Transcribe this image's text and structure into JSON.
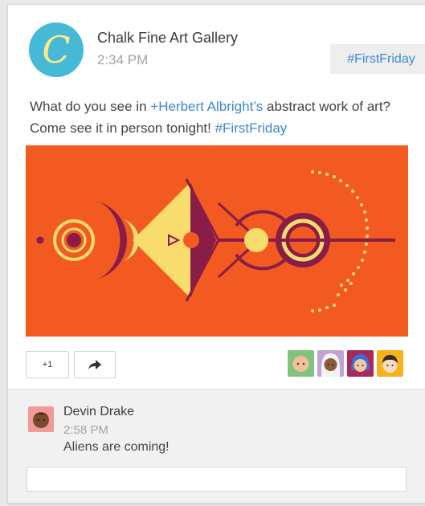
{
  "post": {
    "author": "Chalk Fine Art Gallery",
    "avatar_letter": "C",
    "time": "2:34 PM",
    "hashtag_chip": "#FirstFriday",
    "text_part1": "What do you see in ",
    "mention": "+Herbert Albright’s",
    "text_part2": " abstract work of art? Come see it in person tonight! ",
    "hashtag": "#FirstFriday"
  },
  "actions": {
    "plus_one_label": "+1",
    "share_icon": "share-arrow-icon"
  },
  "sharers": [
    "sharer-avatar-blonde",
    "sharer-avatar-white-hair",
    "sharer-avatar-blue-hair",
    "sharer-avatar-dark-hair"
  ],
  "comment": {
    "author": "Devin Drake",
    "time": "2:58 PM",
    "text": "Aliens are coming!"
  },
  "comment_input": {
    "value": "",
    "placeholder": ""
  },
  "colors": {
    "accent_link": "#3e86d7",
    "avatar_bg": "#45b9d6",
    "art_bg": "#f25a21",
    "art_dark": "#8a1c48",
    "art_yellow": "#f8dd6e"
  }
}
